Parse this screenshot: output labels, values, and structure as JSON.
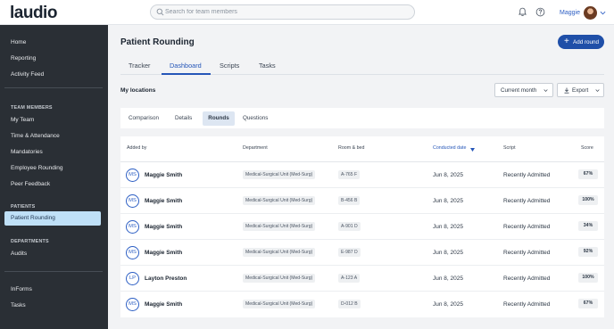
{
  "app": {
    "logo": "laudio",
    "search_placeholder": "Search for team members",
    "user_name": "Maggie"
  },
  "sidebar": {
    "top_items": [
      {
        "label": "Home"
      },
      {
        "label": "Reporting"
      },
      {
        "label": "Activity Feed"
      }
    ],
    "team_members_heading": "TEAM MEMBERS",
    "team_items": [
      {
        "label": "My Team"
      },
      {
        "label": "Time & Attendance"
      },
      {
        "label": "Mandatories"
      },
      {
        "label": "Employee Rounding"
      },
      {
        "label": "Peer Feedback"
      }
    ],
    "patients_heading": "PATIENTS",
    "patients_active": "Patient Rounding",
    "departments_heading": "DEPARTMENTS",
    "departments_items": [
      {
        "label": "Audits"
      }
    ],
    "bottom_items": [
      {
        "label": "InForms"
      },
      {
        "label": "Tasks"
      }
    ]
  },
  "page": {
    "title": "Patient Rounding",
    "add_button_label": "Add round",
    "tabs": [
      {
        "label": "Tracker"
      },
      {
        "label": "Dashboard"
      },
      {
        "label": "Scripts"
      },
      {
        "label": "Tasks"
      }
    ],
    "active_tab": "Dashboard",
    "section_title": "My locations",
    "period_dropdown": "Current month",
    "export_label": "Export",
    "subtabs": [
      {
        "label": "Comparison"
      },
      {
        "label": "Details"
      },
      {
        "label": "Rounds"
      },
      {
        "label": "Questions"
      }
    ],
    "active_subtab": "Rounds"
  },
  "table": {
    "columns": {
      "added_by": "Added by",
      "department": "Department",
      "room_bed": "Room & bed",
      "conducted_date": "Conducted date",
      "script": "Script",
      "score": "Score"
    },
    "sorted_column": "Conducted date",
    "sort_direction": "descending",
    "rows": [
      {
        "initials": "MS",
        "name": "Maggie Smith",
        "department": "Medical-Surgical Unit (Med-Surg)",
        "room": "A-765 F",
        "date": "Jun 8, 2025",
        "script": "Recently Admitted",
        "score": "67%"
      },
      {
        "initials": "MS",
        "name": "Maggie Smith",
        "department": "Medical-Surgical Unit (Med-Surg)",
        "room": "B-456 B",
        "date": "Jun 8, 2025",
        "script": "Recently Admitted",
        "score": "100%"
      },
      {
        "initials": "MS",
        "name": "Maggie Smith",
        "department": "Medical-Surgical Unit (Med-Surg)",
        "room": "A-901 D",
        "date": "Jun 8, 2025",
        "script": "Recently Admitted",
        "score": "34%"
      },
      {
        "initials": "MS",
        "name": "Maggie Smith",
        "department": "Medical-Surgical Unit (Med-Surg)",
        "room": "E-987 D",
        "date": "Jun 8, 2025",
        "script": "Recently Admitted",
        "score": "92%"
      },
      {
        "initials": "LP",
        "name": "Layton Preston",
        "department": "Medical-Surgical Unit (Med-Surg)",
        "room": "A-123 A",
        "date": "Jun 8, 2025",
        "script": "Recently Admitted",
        "score": "100%"
      },
      {
        "initials": "MS",
        "name": "Maggie Smith",
        "department": "Medical-Surgical Unit (Med-Surg)",
        "room": "D-012 B",
        "date": "Jun 8, 2025",
        "script": "Recently Admitted",
        "score": "67%"
      }
    ]
  },
  "icons": {
    "search": "search-icon",
    "notifications": "bell-icon",
    "help": "help-icon",
    "add": "plus-icon",
    "export": "download-icon",
    "dropdown": "chevron-down-icon",
    "sort": "sort-down-icon"
  },
  "colors": {
    "brand_blue": "#1f4fa8",
    "accent_blue": "#2556b8",
    "sidebar_bg": "#2a2f35",
    "sidebar_active": "#bfe0f7"
  }
}
